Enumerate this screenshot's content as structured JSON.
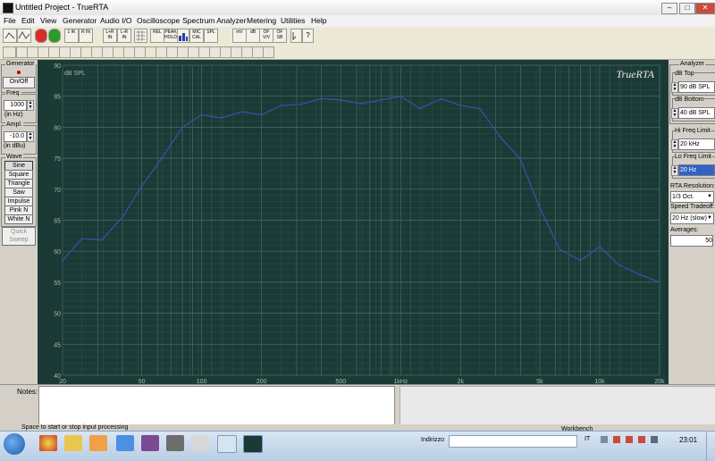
{
  "window": {
    "title": "Untitled Project - TrueRTA",
    "minimize": "–",
    "maximize": "□",
    "close": "✕"
  },
  "menu": [
    "File",
    "Edit",
    "View",
    "Generator",
    "Audio I/O",
    "Oscilloscope",
    "Spectrum Analyzer",
    "Metering",
    "Utilities",
    "Help"
  ],
  "toolbar": {
    "buttons": [
      "1\nIK",
      "R\nIN",
      "L+R\nIN",
      "L-R\nIN",
      "REL",
      "PEAK\nHOLD",
      "MIC\nCAL",
      "SPL",
      "mV",
      "dB",
      "OF\nV/V",
      "OF\nSB"
    ],
    "icons": [
      "arrow-icon",
      "waveform-icon",
      "stop-icon",
      "play-icon",
      "grid-icon",
      "bar-chart-icon",
      "help-icon"
    ]
  },
  "generator": {
    "title": "Generator",
    "onoff_label": "On/Off",
    "freq_label": "Freq.",
    "freq_value": "1000",
    "freq_unit": "(in Hz)",
    "ampl_label": "Ampl.",
    "ampl_value": "-10.0",
    "ampl_unit": "(in dBu)",
    "wave_label": "Wave",
    "waves": [
      "Sine",
      "Square",
      "Triangle",
      "Saw",
      "Impulse",
      "Pink N",
      "White N"
    ],
    "quick_sweep": "Quick\nSweep"
  },
  "analyzer": {
    "title": "Analyzer",
    "db_top_label": "dB Top",
    "db_top_value": "90 dB SPL",
    "db_bottom_label": "dB Bottom",
    "db_bottom_value": "40 dB SPL",
    "hi_freq_label": "Hi Freq Limit",
    "hi_freq_value": "20 kHz",
    "lo_freq_label": "Lo Freq Limit",
    "lo_freq_value": "20 Hz",
    "resolution_label": "RTA Resolution:",
    "resolution_value": "1/3 Oct.",
    "speed_label": "Speed Tradeoff:",
    "speed_value": "20 Hz (slow)",
    "averages_label": "Averages:",
    "averages_value": "50"
  },
  "notes": {
    "label": "Notes:"
  },
  "status": {
    "text": "Space to start or stop input processing"
  },
  "taskbar": {
    "address_label": "Indirizzo",
    "lang": "IT",
    "time": "23:01",
    "tray_app": "Workbench"
  },
  "colors": {
    "chart_bg": "#1b3a36",
    "grid": "#46726b",
    "line": "#3a4fae",
    "label": "#a8b8a8"
  },
  "chart_data": {
    "type": "line",
    "title": "",
    "brand": "TrueRTA",
    "ylabel": "dB SPL",
    "ylim": [
      40,
      90
    ],
    "yticks": [
      40,
      45,
      50,
      55,
      60,
      65,
      70,
      75,
      80,
      85,
      90
    ],
    "x_scale": "log",
    "xlim": [
      20,
      20000
    ],
    "xtick_labels": [
      {
        "v": 20,
        "l": "20"
      },
      {
        "v": 50,
        "l": "50"
      },
      {
        "v": 100,
        "l": "100"
      },
      {
        "v": 200,
        "l": "200"
      },
      {
        "v": 500,
        "l": "500"
      },
      {
        "v": 1000,
        "l": "1kHz"
      },
      {
        "v": 2000,
        "l": "2k"
      },
      {
        "v": 5000,
        "l": "5k"
      },
      {
        "v": 10000,
        "l": "10k"
      },
      {
        "v": 20000,
        "l": "20k"
      }
    ],
    "grid": true,
    "series": [
      {
        "x": [
          20,
          25,
          31.5,
          40,
          50,
          63,
          80,
          100,
          125,
          160,
          200,
          250,
          315,
          400,
          500,
          630,
          800,
          1000,
          1250,
          1600,
          2000,
          2500,
          3150,
          4000,
          5000,
          6300,
          8000,
          10000,
          12500,
          16000,
          20000
        ],
        "values": [
          58.5,
          62.0,
          61.8,
          65.5,
          70.5,
          75.0,
          80.0,
          82.0,
          81.5,
          82.5,
          82.0,
          83.5,
          83.7,
          84.6,
          84.4,
          83.8,
          84.4,
          85.0,
          83.0,
          84.6,
          83.5,
          83.0,
          78.5,
          74.8,
          67.0,
          60.3,
          58.5,
          60.7,
          57.8,
          56.2,
          55.0
        ]
      }
    ]
  }
}
